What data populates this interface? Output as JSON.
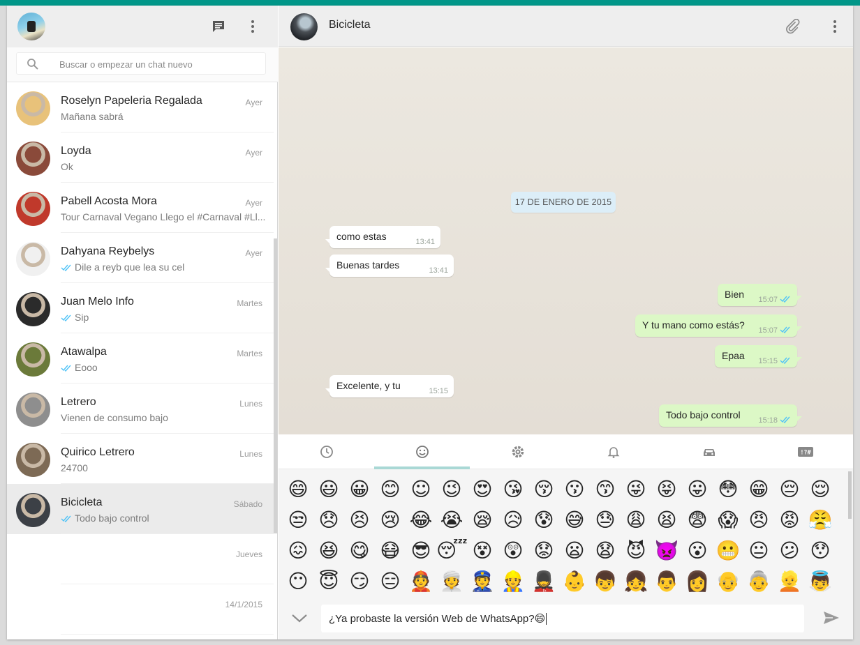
{
  "sidebar": {
    "search": {
      "placeholder": "Buscar o empezar un chat nuevo",
      "value": ""
    },
    "header_icons": [
      "chat-icon",
      "menu-icon"
    ],
    "chats": [
      {
        "name": "Roselyn Papeleria Regalada",
        "time": "Ayer",
        "message": "Mañana sabrá",
        "ticks": false,
        "avatar_color": "#e8c27a"
      },
      {
        "name": "Loyda",
        "time": "Ayer",
        "message": "Ok",
        "ticks": false,
        "avatar_color": "#8a4a3a"
      },
      {
        "name": "Pabell Acosta Mora",
        "time": "Ayer",
        "message": "Tour Carnaval Vegano Llego el #Carnaval #Ll...",
        "ticks": false,
        "avatar_color": "#c0392b"
      },
      {
        "name": "Dahyana Reybelys",
        "time": "Ayer",
        "message": "Dile a reyb que lea su cel",
        "ticks": true,
        "avatar_color": "#f0f0f0"
      },
      {
        "name": "Juan Melo Info",
        "time": "Martes",
        "message": "Sip",
        "ticks": true,
        "avatar_color": "#2b2b2b"
      },
      {
        "name": "Atawalpa",
        "time": "Martes",
        "message": "Eooo",
        "ticks": true,
        "avatar_color": "#6b7a3a"
      },
      {
        "name": "Letrero",
        "time": "Lunes",
        "message": "Vienen de consumo bajo",
        "ticks": false,
        "avatar_color": "#8e8e8e"
      },
      {
        "name": "Quirico Letrero",
        "time": "Lunes",
        "message": "24700",
        "ticks": false,
        "avatar_color": "#7d6a55"
      },
      {
        "name": "Bicicleta",
        "time": "Sábado",
        "message": "Todo bajo control",
        "ticks": true,
        "avatar_color": "#3c4046",
        "active": true
      },
      {
        "name": "",
        "time": "Jueves",
        "message": "",
        "ticks": false,
        "avatar_color": ""
      },
      {
        "name": "",
        "time": "14/1/2015",
        "message": "",
        "ticks": false,
        "avatar_color": ""
      }
    ]
  },
  "conversation": {
    "contact_name": "Bicicleta",
    "header_icons": [
      "paperclip-icon",
      "menu-icon"
    ],
    "date_divider": "17 DE ENERO DE 2015",
    "messages": [
      {
        "direction": "in",
        "text": "como estas",
        "time": "13:41"
      },
      {
        "direction": "in",
        "text": "Buenas tardes",
        "time": "13:41"
      },
      {
        "direction": "out",
        "text": "Bien",
        "time": "15:07"
      },
      {
        "direction": "out",
        "text": "Y tu mano como estás?",
        "time": "15:07"
      },
      {
        "direction": "out",
        "text": "Epaa",
        "time": "15:15"
      },
      {
        "direction": "in",
        "text": "Excelente, y tu",
        "time": "15:15"
      },
      {
        "direction": "out",
        "text": "Todo bajo control",
        "time": "15:18"
      }
    ]
  },
  "emoji_panel": {
    "tabs": [
      "recent-icon",
      "smiley-icon",
      "gear-icon",
      "bell-icon",
      "car-icon",
      "symbols-icon"
    ],
    "active_tab": 1,
    "rows": [
      [
        "😄",
        "😃",
        "😀",
        "😊",
        "☺",
        "😉",
        "😍",
        "😘",
        "😚",
        "😗",
        "😙",
        "😜",
        "😝",
        "😛",
        "😳",
        "😁",
        "😔",
        "😌"
      ],
      [
        "😒",
        "😞",
        "😣",
        "😢",
        "😂",
        "😭",
        "😪",
        "😥",
        "😰",
        "😅",
        "😓",
        "😩",
        "😫",
        "😨",
        "😱",
        "😠",
        "😡",
        "😤"
      ],
      [
        "😖",
        "😆",
        "😋",
        "😷",
        "😎",
        "😴",
        "😵",
        "😲",
        "😟",
        "😦",
        "😧",
        "😈",
        "👿",
        "😮",
        "😬",
        "😐",
        "😕",
        "😯"
      ],
      [
        "😶",
        "😇",
        "😏",
        "😑",
        "👲",
        "👳",
        "👮",
        "👷",
        "💂",
        "👶",
        "👦",
        "👧",
        "👨",
        "👩",
        "👴",
        "👵",
        "👱",
        "👼"
      ]
    ]
  },
  "composer": {
    "text": "¿Ya probaste la versión Web de WhatsApp?",
    "emoji": "😄"
  },
  "colors": {
    "accent": "#009688",
    "outgoing_bubble": "#dcf8c6",
    "incoming_bubble": "#ffffff",
    "ticks": "#4fc3f7",
    "date_pill": "#dceef8"
  }
}
